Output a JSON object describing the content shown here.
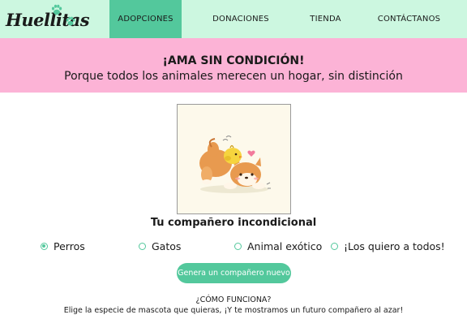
{
  "brand": {
    "name": "Huellitas",
    "accent_color": "#53c89c",
    "nav_bg": "#ccf7e0",
    "banner_bg": "#fcb3d6",
    "logo_icon": "paw-icon"
  },
  "nav": {
    "items": [
      {
        "label": "ADOPCIONES",
        "active": true
      },
      {
        "label": "DONACIONES",
        "active": false
      },
      {
        "label": "TIENDA",
        "active": false
      },
      {
        "label": "CONTÁCTANOS",
        "active": false
      }
    ]
  },
  "banner": {
    "title": "¡AMA SIN CONDICIÓN!",
    "subtitle": "Porque todos los animales merecen un hogar, sin distinción"
  },
  "pet": {
    "illustration": "shiba-puppy-with-chick",
    "caption": "Tu compañero incondicional"
  },
  "options": {
    "selected_index": 0,
    "items": [
      {
        "label": "Perros"
      },
      {
        "label": "Gatos"
      },
      {
        "label": "Animal exótico"
      },
      {
        "label": "¡Los quiero a todos!"
      }
    ]
  },
  "generate_button": {
    "label": "Genera un compañero nuevo"
  },
  "how_it_works": {
    "title": "¿CÓMO FUNCIONA?",
    "text": "Elige la especie de mascota que quieras, ¡Y te mostramos un futuro compañero al azar!"
  }
}
